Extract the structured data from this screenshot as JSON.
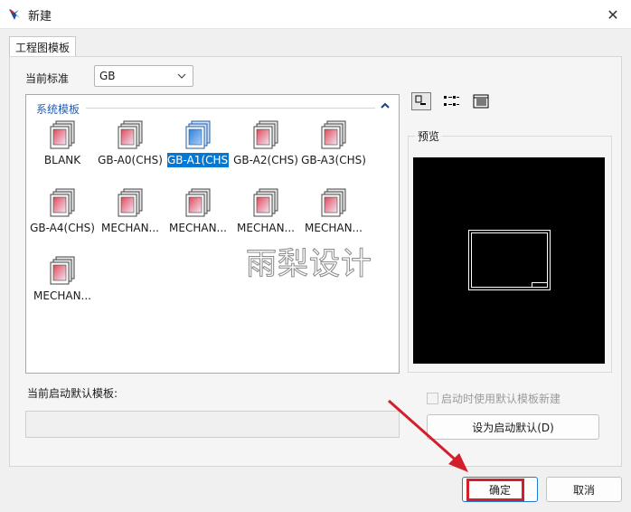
{
  "window": {
    "title": "新建",
    "close_glyph": "✕"
  },
  "tabs": [
    {
      "label": "工程图模板",
      "active": true
    }
  ],
  "standard": {
    "label": "当前标准",
    "value": "GB"
  },
  "template_group": {
    "title": "系统模板",
    "items": [
      {
        "label": "BLANK",
        "selected": false
      },
      {
        "label": "GB-A0(CHS)",
        "selected": false
      },
      {
        "label": "GB-A1(CHS)",
        "selected": true
      },
      {
        "label": "GB-A2(CHS)",
        "selected": false
      },
      {
        "label": "GB-A3(CHS)",
        "selected": false
      },
      {
        "label": "GB-A4(CHS)",
        "selected": false
      },
      {
        "label": "MECHAN...",
        "selected": false
      },
      {
        "label": "MECHAN...",
        "selected": false
      },
      {
        "label": "MECHAN...",
        "selected": false
      },
      {
        "label": "MECHAN...",
        "selected": false
      },
      {
        "label": "MECHAN...",
        "selected": false
      }
    ]
  },
  "view_modes": [
    {
      "icon": "large-icons-view-icon",
      "active": true
    },
    {
      "icon": "list-view-icon",
      "active": false
    },
    {
      "icon": "details-view-icon",
      "active": false
    }
  ],
  "preview": {
    "title": "预览"
  },
  "default_template": {
    "label": "当前启动默认模板:",
    "value": ""
  },
  "startup_checkbox": {
    "label": "启动时使用默认模板新建",
    "checked": false,
    "enabled": false
  },
  "buttons": {
    "set_default": "设为启动默认(D)",
    "ok": "确定",
    "cancel": "取消"
  },
  "watermark": "雨梨设计",
  "colors": {
    "selection": "#0078d7",
    "group_title": "#1f5fbf",
    "highlight": "#d21f2b"
  }
}
